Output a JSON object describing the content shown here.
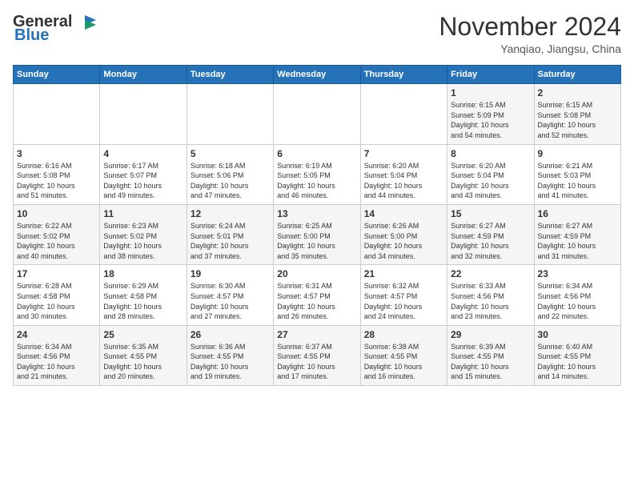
{
  "header": {
    "logo": {
      "general": "General",
      "blue": "Blue"
    },
    "title": "November 2024",
    "location": "Yanqiao, Jiangsu, China"
  },
  "calendar": {
    "days_of_week": [
      "Sunday",
      "Monday",
      "Tuesday",
      "Wednesday",
      "Thursday",
      "Friday",
      "Saturday"
    ],
    "weeks": [
      [
        {
          "day": "",
          "info": ""
        },
        {
          "day": "",
          "info": ""
        },
        {
          "day": "",
          "info": ""
        },
        {
          "day": "",
          "info": ""
        },
        {
          "day": "",
          "info": ""
        },
        {
          "day": "1",
          "info": "Sunrise: 6:15 AM\nSunset: 5:09 PM\nDaylight: 10 hours\nand 54 minutes."
        },
        {
          "day": "2",
          "info": "Sunrise: 6:15 AM\nSunset: 5:08 PM\nDaylight: 10 hours\nand 52 minutes."
        }
      ],
      [
        {
          "day": "3",
          "info": "Sunrise: 6:16 AM\nSunset: 5:08 PM\nDaylight: 10 hours\nand 51 minutes."
        },
        {
          "day": "4",
          "info": "Sunrise: 6:17 AM\nSunset: 5:07 PM\nDaylight: 10 hours\nand 49 minutes."
        },
        {
          "day": "5",
          "info": "Sunrise: 6:18 AM\nSunset: 5:06 PM\nDaylight: 10 hours\nand 47 minutes."
        },
        {
          "day": "6",
          "info": "Sunrise: 6:19 AM\nSunset: 5:05 PM\nDaylight: 10 hours\nand 46 minutes."
        },
        {
          "day": "7",
          "info": "Sunrise: 6:20 AM\nSunset: 5:04 PM\nDaylight: 10 hours\nand 44 minutes."
        },
        {
          "day": "8",
          "info": "Sunrise: 6:20 AM\nSunset: 5:04 PM\nDaylight: 10 hours\nand 43 minutes."
        },
        {
          "day": "9",
          "info": "Sunrise: 6:21 AM\nSunset: 5:03 PM\nDaylight: 10 hours\nand 41 minutes."
        }
      ],
      [
        {
          "day": "10",
          "info": "Sunrise: 6:22 AM\nSunset: 5:02 PM\nDaylight: 10 hours\nand 40 minutes."
        },
        {
          "day": "11",
          "info": "Sunrise: 6:23 AM\nSunset: 5:02 PM\nDaylight: 10 hours\nand 38 minutes."
        },
        {
          "day": "12",
          "info": "Sunrise: 6:24 AM\nSunset: 5:01 PM\nDaylight: 10 hours\nand 37 minutes."
        },
        {
          "day": "13",
          "info": "Sunrise: 6:25 AM\nSunset: 5:00 PM\nDaylight: 10 hours\nand 35 minutes."
        },
        {
          "day": "14",
          "info": "Sunrise: 6:26 AM\nSunset: 5:00 PM\nDaylight: 10 hours\nand 34 minutes."
        },
        {
          "day": "15",
          "info": "Sunrise: 6:27 AM\nSunset: 4:59 PM\nDaylight: 10 hours\nand 32 minutes."
        },
        {
          "day": "16",
          "info": "Sunrise: 6:27 AM\nSunset: 4:59 PM\nDaylight: 10 hours\nand 31 minutes."
        }
      ],
      [
        {
          "day": "17",
          "info": "Sunrise: 6:28 AM\nSunset: 4:58 PM\nDaylight: 10 hours\nand 30 minutes."
        },
        {
          "day": "18",
          "info": "Sunrise: 6:29 AM\nSunset: 4:58 PM\nDaylight: 10 hours\nand 28 minutes."
        },
        {
          "day": "19",
          "info": "Sunrise: 6:30 AM\nSunset: 4:57 PM\nDaylight: 10 hours\nand 27 minutes."
        },
        {
          "day": "20",
          "info": "Sunrise: 6:31 AM\nSunset: 4:57 PM\nDaylight: 10 hours\nand 26 minutes."
        },
        {
          "day": "21",
          "info": "Sunrise: 6:32 AM\nSunset: 4:57 PM\nDaylight: 10 hours\nand 24 minutes."
        },
        {
          "day": "22",
          "info": "Sunrise: 6:33 AM\nSunset: 4:56 PM\nDaylight: 10 hours\nand 23 minutes."
        },
        {
          "day": "23",
          "info": "Sunrise: 6:34 AM\nSunset: 4:56 PM\nDaylight: 10 hours\nand 22 minutes."
        }
      ],
      [
        {
          "day": "24",
          "info": "Sunrise: 6:34 AM\nSunset: 4:56 PM\nDaylight: 10 hours\nand 21 minutes."
        },
        {
          "day": "25",
          "info": "Sunrise: 6:35 AM\nSunset: 4:55 PM\nDaylight: 10 hours\nand 20 minutes."
        },
        {
          "day": "26",
          "info": "Sunrise: 6:36 AM\nSunset: 4:55 PM\nDaylight: 10 hours\nand 19 minutes."
        },
        {
          "day": "27",
          "info": "Sunrise: 6:37 AM\nSunset: 4:55 PM\nDaylight: 10 hours\nand 17 minutes."
        },
        {
          "day": "28",
          "info": "Sunrise: 6:38 AM\nSunset: 4:55 PM\nDaylight: 10 hours\nand 16 minutes."
        },
        {
          "day": "29",
          "info": "Sunrise: 6:39 AM\nSunset: 4:55 PM\nDaylight: 10 hours\nand 15 minutes."
        },
        {
          "day": "30",
          "info": "Sunrise: 6:40 AM\nSunset: 4:55 PM\nDaylight: 10 hours\nand 14 minutes."
        }
      ]
    ]
  }
}
